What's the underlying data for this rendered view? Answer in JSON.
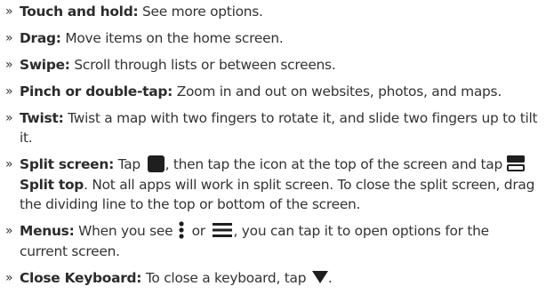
{
  "bullet": "»",
  "items": [
    {
      "term": "Touch and hold:",
      "text": " See more options."
    },
    {
      "term": "Drag:",
      "text": " Move items on the home screen."
    },
    {
      "term": "Swipe:",
      "text": " Scroll through lists or between screens."
    },
    {
      "term": "Pinch or double-tap:",
      "text": " Zoom in and out on websites, photos, and maps."
    },
    {
      "term": "Twist:",
      "text": " Twist a map with two fingers to rotate it, and slide two fingers up to tilt it."
    },
    {
      "term": "Split screen:",
      "text_a": " Tap ",
      "text_b": ", then tap the icon at the top of the screen and tap ",
      "split_top_label": "Split top",
      "text_c": ". Not all apps will work in split screen. To close the split screen, drag the dividing line to the top or bottom of the screen."
    },
    {
      "term": "Menus:",
      "text_a": " When you see ",
      "text_b": " or ",
      "text_c": ", you can tap it to open options for the current screen."
    },
    {
      "term": "Close Keyboard:",
      "text_a": " To close a keyboard, tap ",
      "text_b": "."
    }
  ],
  "icons": {
    "recent_apps": "square-recent-apps-icon",
    "split_top": "split-top-icon",
    "more_vertical": "vertical-dots-menu-icon",
    "menu": "hamburger-menu-icon",
    "close_keyboard": "down-triangle-icon"
  },
  "colors": {
    "text": "#333333",
    "icon": "#1f1f1f"
  }
}
